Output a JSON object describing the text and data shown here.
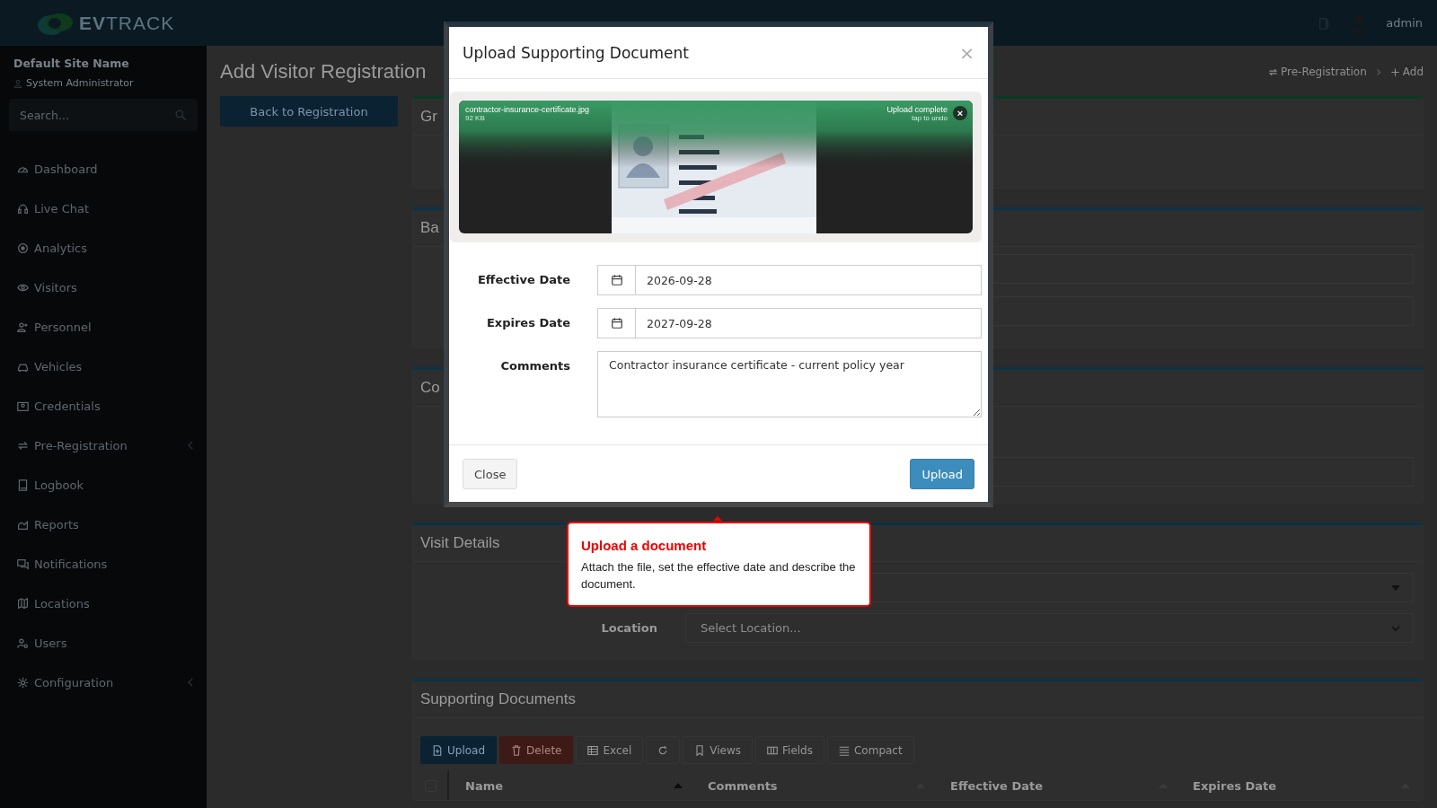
{
  "header": {
    "brand": "**EV**TRACK",
    "user": "admin"
  },
  "sidebar": {
    "site_name": "Default Site Name",
    "role": "System Administrator",
    "search": {
      "placeholder": "Search..."
    },
    "items": [
      {
        "label": "Dashboard",
        "has_submenu": false
      },
      {
        "label": "Live Chat",
        "has_submenu": false
      },
      {
        "label": "Analytics",
        "has_submenu": false
      },
      {
        "label": "Visitors",
        "has_submenu": false
      },
      {
        "label": "Personnel",
        "has_submenu": false
      },
      {
        "label": "Vehicles",
        "has_submenu": false
      },
      {
        "label": "Credentials",
        "has_submenu": false
      },
      {
        "label": "Pre-Registration",
        "has_submenu": true
      },
      {
        "label": "Logbook",
        "has_submenu": false
      },
      {
        "label": "Reports",
        "has_submenu": false
      },
      {
        "label": "Notifications",
        "has_submenu": false
      },
      {
        "label": "Locations",
        "has_submenu": false
      },
      {
        "label": "Users",
        "has_submenu": false
      },
      {
        "label": "Configuration",
        "has_submenu": true
      }
    ]
  },
  "page": {
    "title": "Add Visitor Registration",
    "back_button": "Back to Registration",
    "breadcrumb": [
      {
        "label": "Pre-Registration"
      },
      {
        "label": "Add"
      }
    ]
  },
  "sections": [
    {
      "title": "Gr",
      "color": "#0a3a24"
    },
    {
      "title": "Ba",
      "color": "#0a3347",
      "fields": [
        {
          "kind": "text"
        },
        {
          "kind": "text"
        }
      ]
    },
    {
      "title": "Co",
      "color": "#0a3347",
      "fields": [
        {
          "kind": "text"
        }
      ]
    },
    {
      "title": "Visit Details",
      "color": "#0a3347",
      "fields": [
        {
          "kind": "select2"
        },
        {
          "kind": "select",
          "label": "Location",
          "placeholder": "Select Location..."
        }
      ]
    }
  ],
  "documents": {
    "title": "Supporting Documents",
    "toolbar": [
      {
        "label": "Upload",
        "kind": "primary"
      },
      {
        "label": "Delete",
        "kind": "danger"
      },
      {
        "label": "Excel",
        "kind": "default"
      },
      {
        "kind": "default"
      },
      {
        "label": "Views",
        "kind": "default"
      },
      {
        "label": "Fields",
        "kind": "default"
      },
      {
        "label": "Compact",
        "kind": "default"
      }
    ],
    "select_all": {
      "checked": false
    },
    "columns": [
      {
        "label": "Name",
        "sorted": true
      },
      {
        "label": "Comments",
        "sorted": false
      },
      {
        "label": "Effective Date",
        "sorted": false
      },
      {
        "label": "Expires Date",
        "sorted": false
      }
    ]
  },
  "modal": {
    "title": "Upload Supporting Document",
    "close": "×",
    "file": {
      "name": "contractor-insurance-certificate.jpg",
      "size": "92 KB",
      "status": "Upload complete",
      "hint": "tap to undo",
      "remove": "×"
    },
    "fields": [
      {
        "label": "Effective Date",
        "kind": "date",
        "value": "2026-09-28"
      },
      {
        "label": "Expires Date",
        "kind": "date",
        "value": "2027-09-28"
      },
      {
        "label": "Comments",
        "kind": "textarea",
        "value": "Contractor insurance certificate - current policy year"
      }
    ],
    "buttons": [
      {
        "label": "Close",
        "kind": "default"
      },
      {
        "label": "Upload",
        "kind": "primary"
      }
    ]
  },
  "tooltip": {
    "title": "Upload a document",
    "text": "Attach the file, set the effective date and describe the document."
  }
}
